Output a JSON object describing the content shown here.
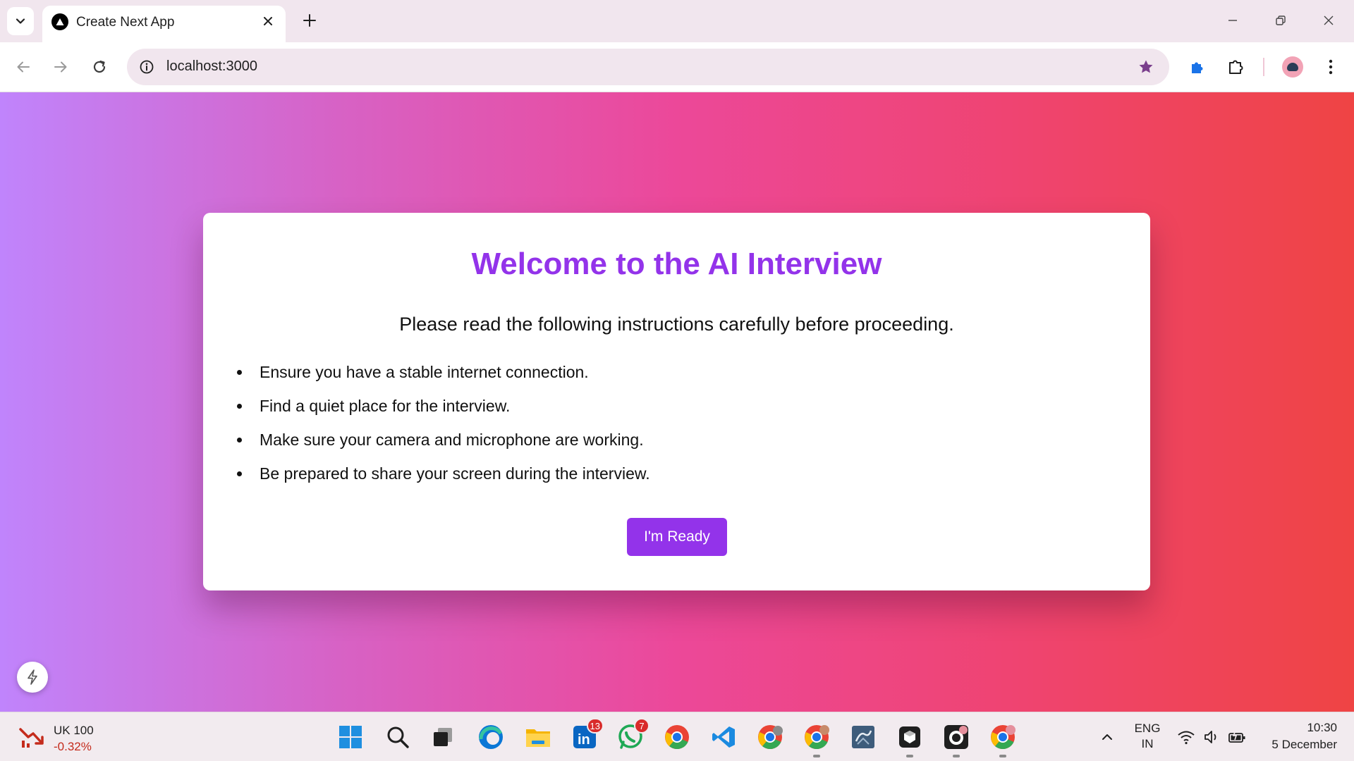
{
  "browser": {
    "tab_title": "Create Next App",
    "url": "localhost:3000",
    "tab_search_icon": "chevron-down-icon",
    "favicon": "nextjs-triangle-icon"
  },
  "page": {
    "title": "Welcome to the AI Interview",
    "subtitle": "Please read the following instructions carefully before proceeding.",
    "instructions": [
      "Ensure you have a stable internet connection.",
      "Find a quiet place for the interview.",
      "Make sure your camera and microphone are working.",
      "Be prepared to share your screen during the interview."
    ],
    "ready_button": "I'm Ready",
    "colors": {
      "accent": "#9333ea",
      "gradient_start": "#c084fc",
      "gradient_mid": "#ec4899",
      "gradient_end": "#ef4444"
    }
  },
  "taskbar": {
    "widget": {
      "name": "UK 100",
      "change": "-0.32%"
    },
    "apps": [
      {
        "name": "start-icon"
      },
      {
        "name": "search-icon"
      },
      {
        "name": "task-view-icon"
      },
      {
        "name": "edge-icon"
      },
      {
        "name": "file-explorer-icon"
      },
      {
        "name": "linkedin-icon",
        "badge": "13"
      },
      {
        "name": "whatsapp-icon",
        "badge": "7"
      },
      {
        "name": "chrome-icon"
      },
      {
        "name": "vscode-icon"
      },
      {
        "name": "chrome-profile-icon"
      },
      {
        "name": "chrome-profile-icon"
      },
      {
        "name": "mysql-workbench-icon"
      },
      {
        "name": "cube-app-icon"
      },
      {
        "name": "github-icon"
      },
      {
        "name": "chrome-profile-icon"
      }
    ],
    "language": {
      "line1": "ENG",
      "line2": "IN"
    },
    "clock": {
      "time": "10:30",
      "date": "5 December"
    }
  }
}
